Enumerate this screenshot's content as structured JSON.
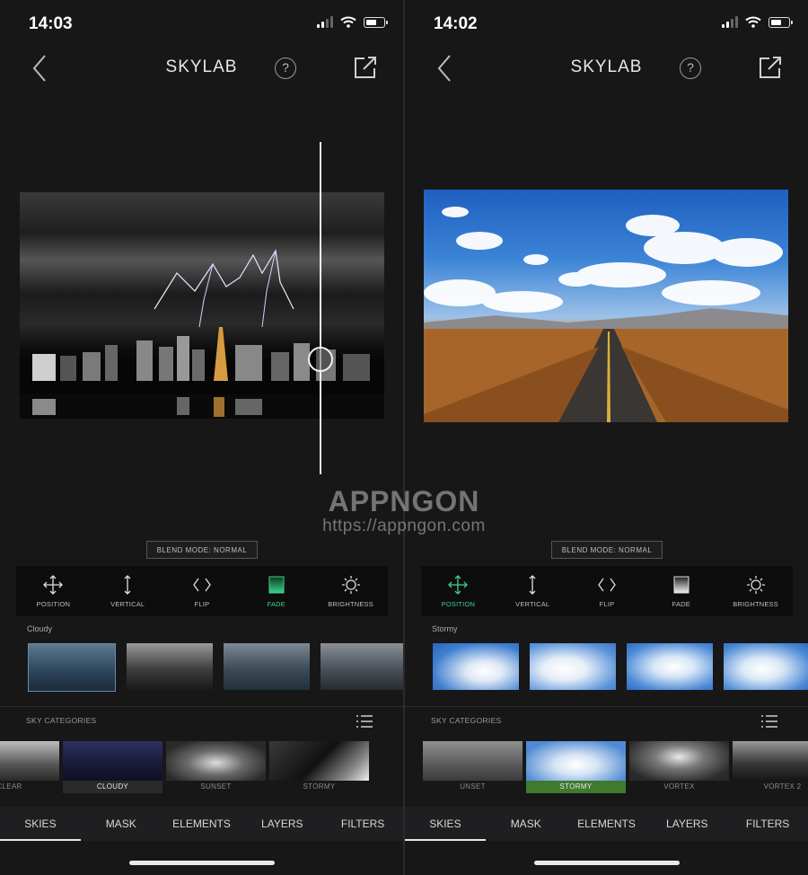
{
  "screens": [
    {
      "time": "14:02",
      "title": "SKYLAB",
      "help": "?",
      "blend_mode": "BLEND MODE: NORMAL",
      "tools": [
        {
          "label": "POSITION",
          "icon": "move-icon"
        },
        {
          "label": "VERTICAL",
          "icon": "vertical-arrows-icon"
        },
        {
          "label": "FLIP",
          "icon": "flip-icon"
        },
        {
          "label": "FADE",
          "icon": "fade-icon"
        },
        {
          "label": "BRIGHTNESS",
          "icon": "sun-icon"
        }
      ],
      "active_tool": "FADE",
      "category_name": "Stormy",
      "sky_categories_label": "SKY CATEGORIES",
      "categories": [
        "UNSET",
        "STORMY",
        "VORTEX",
        "VORTEX 2"
      ],
      "active_category": "STORMY",
      "tabs": [
        "SKIES",
        "MASK",
        "ELEMENTS",
        "LAYERS",
        "FILTERS"
      ],
      "active_tab": "SKIES"
    },
    {
      "time": "14:03",
      "title": "SKYLAB",
      "help": "?",
      "blend_mode": "BLEND MODE: NORMAL",
      "tools": [
        {
          "label": "POSITION",
          "icon": "move-icon"
        },
        {
          "label": "VERTICAL",
          "icon": "vertical-arrows-icon"
        },
        {
          "label": "FLIP",
          "icon": "flip-icon"
        },
        {
          "label": "FADE",
          "icon": "fade-icon"
        },
        {
          "label": "BRIGHTNESS",
          "icon": "sun-icon"
        }
      ],
      "active_tool": "POSITION",
      "category_name": "Cloudy",
      "sky_categories_label": "SKY CATEGORIES",
      "categories": [
        "CLEAR",
        "CLOUDY",
        "SUNSET",
        "STORMY"
      ],
      "active_category": "CLOUDY",
      "tabs": [
        "SKIES",
        "MASK",
        "ELEMENTS",
        "LAYERS",
        "FILTERS"
      ],
      "active_tab": "SKIES"
    }
  ],
  "watermark": {
    "brand": "APPNGON",
    "url": "https://appngon.com"
  },
  "colors": {
    "accent": "#3fcf8e",
    "background": "#171718",
    "tabbar": "#1f1f21"
  }
}
